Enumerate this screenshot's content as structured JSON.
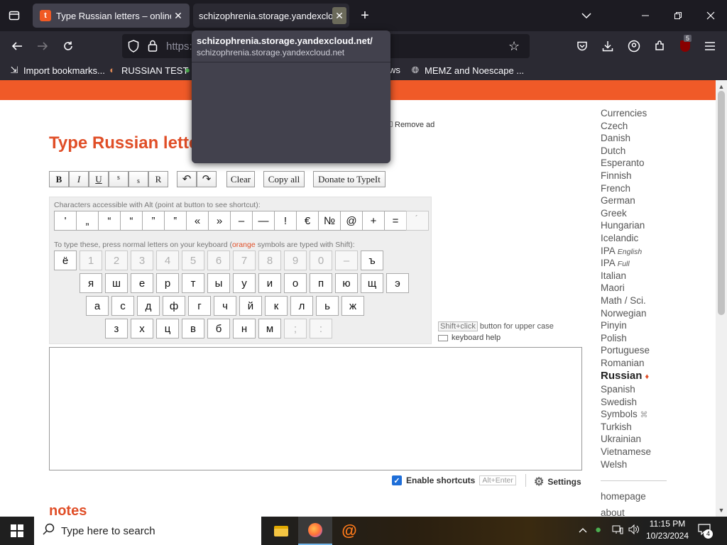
{
  "browser": {
    "tabs": [
      {
        "title": "Type Russian letters – online Ru",
        "close": "✕",
        "active": true
      },
      {
        "title": "schizophrenia.storage.yandexcloud.net",
        "close": "✕",
        "active": false
      }
    ],
    "new_tab": "+",
    "url_display": "https:",
    "tooltip": {
      "title": "schizophrenia.storage.yandexcloud.net/",
      "url": "schizophrenia.storage.yandexcloud.net"
    },
    "bookmarks": [
      "Import bookmarks...",
      "RUSSIAN TEST",
      "ws",
      "MEMZ and Noescape ..."
    ],
    "extension_badge": "5"
  },
  "page": {
    "title": "Type Russian lette",
    "remove_ad": "Remove ad",
    "format_buttons": [
      "B",
      "I",
      "U",
      "s",
      "s",
      "R"
    ],
    "undo": "↶",
    "redo": "↷",
    "clear": "Clear",
    "copy_all": "Copy all",
    "donate": "Donate to TypeIt",
    "alt_hint": "Characters accessible with Alt (point at button to see shortcut):",
    "alt_chars": [
      "'",
      "„",
      "“",
      "“",
      "”",
      "‟",
      "«",
      "»",
      "–",
      "—",
      "!",
      "€",
      "№",
      "@",
      "+",
      "=",
      "́"
    ],
    "letters_hint_prefix": "To type these, press normal letters on your keyboard (",
    "letters_hint_orange": "orange",
    "letters_hint_suffix": " symbols are typed with Shift):",
    "row1": [
      "ё",
      "1",
      "2",
      "3",
      "4",
      "5",
      "6",
      "7",
      "8",
      "9",
      "0",
      "–",
      "ъ"
    ],
    "row2": [
      "я",
      "ш",
      "е",
      "р",
      "т",
      "ы",
      "у",
      "и",
      "о",
      "п",
      "ю",
      "щ",
      "э"
    ],
    "row3": [
      "а",
      "с",
      "д",
      "ф",
      "г",
      "ч",
      "й",
      "к",
      "л",
      "ь",
      "ж"
    ],
    "row4": [
      "з",
      "х",
      "ц",
      "в",
      "б",
      "н",
      "м",
      ";",
      ":"
    ],
    "shift_tag": "Shift+click",
    "shift_note": " button for upper case",
    "keyboard_help": "keyboard help",
    "enable_shortcuts": "Enable shortcuts",
    "shortcut_key": "Alt+Enter",
    "settings": "Settings",
    "notes": "notes"
  },
  "sidebar": {
    "languages": [
      {
        "name": "Currencies"
      },
      {
        "name": "Czech"
      },
      {
        "name": "Danish"
      },
      {
        "name": "Dutch"
      },
      {
        "name": "Esperanto"
      },
      {
        "name": "Finnish"
      },
      {
        "name": "French"
      },
      {
        "name": "German"
      },
      {
        "name": "Greek"
      },
      {
        "name": "Hungarian"
      },
      {
        "name": "Icelandic"
      },
      {
        "name": "IPA",
        "sub": "English"
      },
      {
        "name": "IPA",
        "sub": "Full"
      },
      {
        "name": "Italian"
      },
      {
        "name": "Maori"
      },
      {
        "name": "Math / Sci."
      },
      {
        "name": "Norwegian"
      },
      {
        "name": "Pinyin"
      },
      {
        "name": "Polish"
      },
      {
        "name": "Portuguese"
      },
      {
        "name": "Romanian"
      },
      {
        "name": "Russian",
        "mark": "♦",
        "active": true
      },
      {
        "name": "Spanish"
      },
      {
        "name": "Swedish"
      },
      {
        "name": "Symbols",
        "mark": "⌘"
      },
      {
        "name": "Turkish"
      },
      {
        "name": "Ukrainian"
      },
      {
        "name": "Vietnamese"
      },
      {
        "name": "Welsh"
      }
    ],
    "homepage": "homepage",
    "about": "about"
  },
  "taskbar": {
    "search_placeholder": "Type here to search",
    "time": "11:15 PM",
    "date": "10/23/2024",
    "notification_count": "4"
  }
}
